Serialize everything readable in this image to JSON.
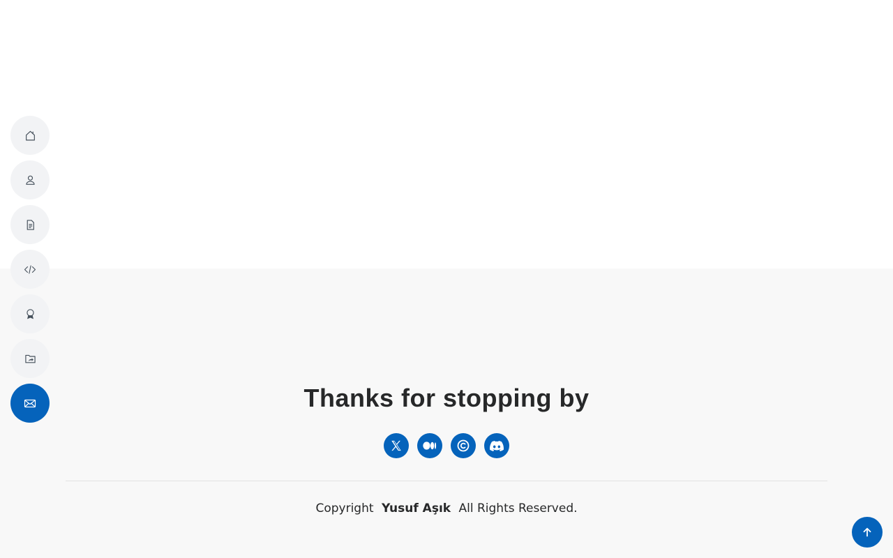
{
  "nav": {
    "items": [
      {
        "icon": "house-icon",
        "active": false
      },
      {
        "icon": "person-icon",
        "active": false
      },
      {
        "icon": "file-text-icon",
        "active": false
      },
      {
        "icon": "code-icon",
        "active": false
      },
      {
        "icon": "award-icon",
        "active": false
      },
      {
        "icon": "folder-symlink-icon",
        "active": false
      },
      {
        "icon": "envelope-icon",
        "active": true
      }
    ]
  },
  "footer": {
    "title": "Thanks for stopping by",
    "social": [
      {
        "icon": "x-twitter-icon"
      },
      {
        "icon": "medium-icon"
      },
      {
        "icon": "c-circle-icon"
      },
      {
        "icon": "discord-icon"
      }
    ],
    "copyright_prefix": "Copyright",
    "copyright_owner": "Yusuf Aşık",
    "copyright_suffix": "All Rights Reserved."
  },
  "colors": {
    "accent": "#0563bb",
    "nav_bg": "#f2f3f5",
    "footer_bg": "#f8f8f8",
    "text": "#272829"
  },
  "back_to_top": {
    "icon": "arrow-up-icon"
  }
}
